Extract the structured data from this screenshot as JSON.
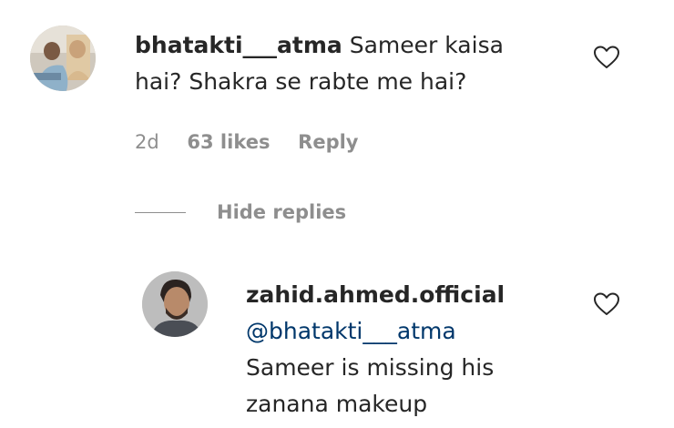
{
  "comment": {
    "username": "bhatakti___atma",
    "text_line1": "Sameer kaisa",
    "text_line2": "hai? Shakra se rabte me hai?",
    "time": "2d",
    "likes": "63 likes",
    "reply_label": "Reply",
    "like_icon": "heart-outline-icon"
  },
  "thread": {
    "hide_replies_label": "Hide replies"
  },
  "reply": {
    "username": "zahid.ahmed.official",
    "mention": "@bhatakti___atma",
    "text_line1": "Sameer is missing his",
    "text_line2": "zanana makeup",
    "like_icon": "heart-outline-icon"
  },
  "colors": {
    "text": "#262626",
    "secondary": "#8e8e8e",
    "mention": "#00376b",
    "background": "#ffffff"
  }
}
